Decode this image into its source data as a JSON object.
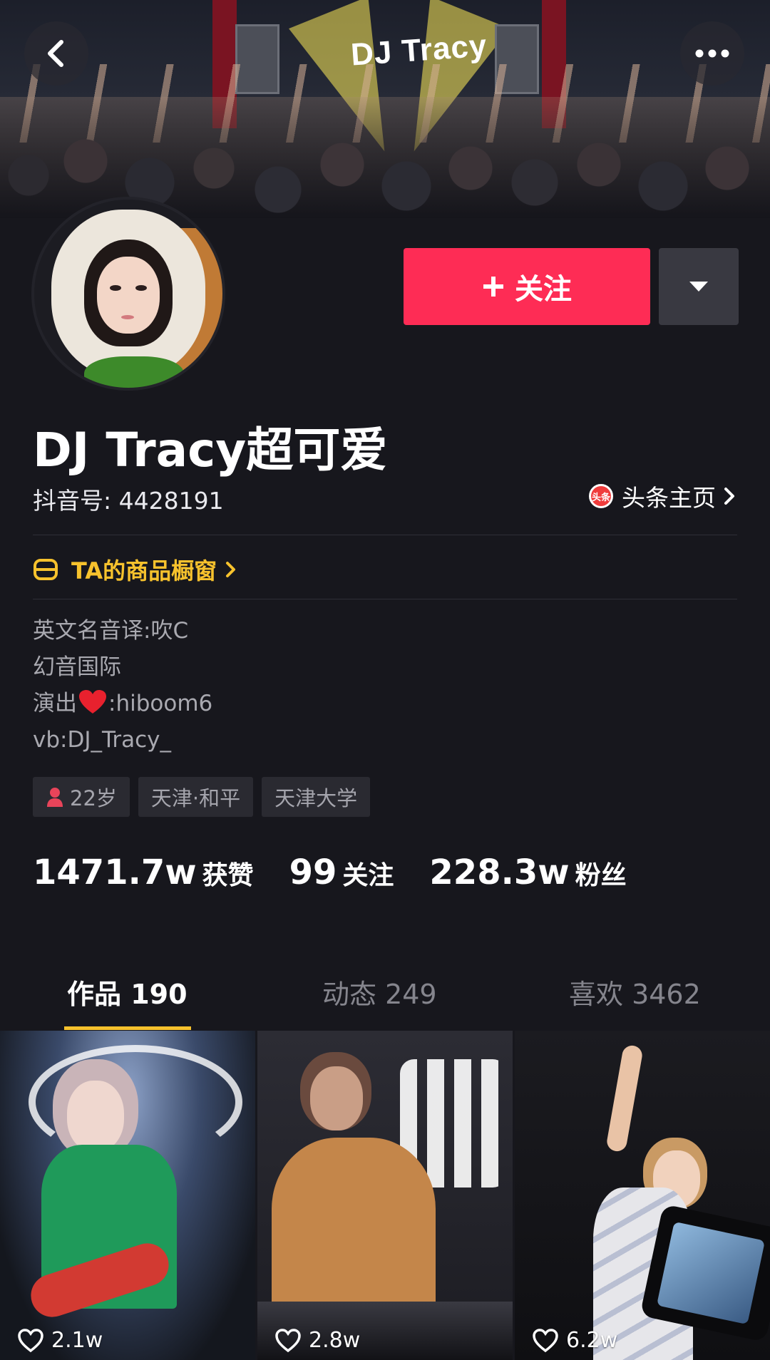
{
  "banner": {
    "stage_logo": "DJ Tracy"
  },
  "profile": {
    "follow_label": "关注",
    "nickname": "DJ Tracy超可爱",
    "douyin_id": "抖音号: 4428191",
    "toutiao_badge": "头条",
    "toutiao_label": "头条主页",
    "shop_label": "TA的商品橱窗",
    "bio_lines": [
      "英文名音译:吹C",
      "幻音国际",
      "演出",
      ":hiboom6",
      "vb:DJ_Tracy_"
    ],
    "tags": [
      "22岁",
      "天津·和平",
      "天津大学"
    ],
    "stats": [
      {
        "value": "1471.7w",
        "label": "获赞"
      },
      {
        "value": "99",
        "label": "关注"
      },
      {
        "value": "228.3w",
        "label": "粉丝"
      }
    ]
  },
  "tabs": [
    {
      "label": "作品 190",
      "active": true
    },
    {
      "label": "动态 249",
      "active": false
    },
    {
      "label": "喜欢 3462",
      "active": false
    }
  ],
  "videos": [
    {
      "likes": "2.1w"
    },
    {
      "likes": "2.8w"
    },
    {
      "likes": "6.2w"
    }
  ],
  "colors": {
    "accent_follow": "#fe2c55",
    "accent_yellow": "#f7c22d",
    "background": "#17171d"
  },
  "icons": [
    "back-arrow-icon",
    "more-dots-icon",
    "plus-icon",
    "caret-down-icon",
    "toutiao-logo-icon",
    "chevron-right-icon",
    "shop-window-icon",
    "heart-emoji-icon",
    "female-icon",
    "heart-outline-icon"
  ]
}
